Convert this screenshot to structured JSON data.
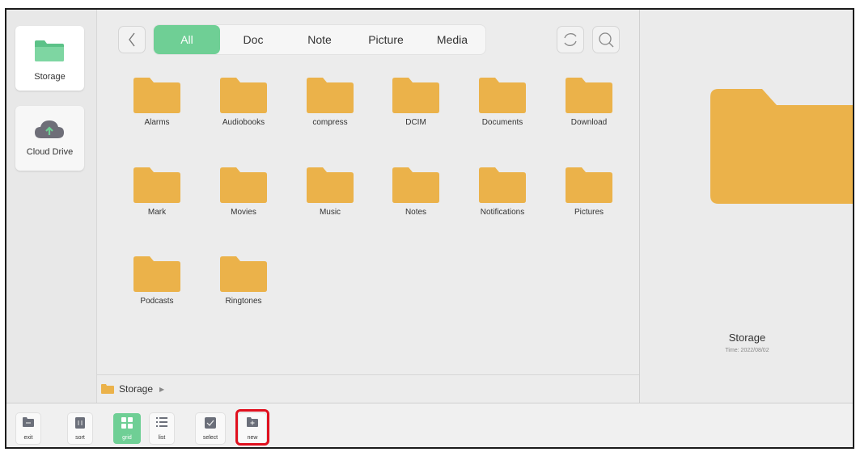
{
  "sidebar": {
    "items": [
      {
        "label": "Storage",
        "icon": "folder-icon",
        "active": true
      },
      {
        "label": "Cloud Drive",
        "icon": "cloud-upload-icon",
        "active": false
      }
    ]
  },
  "tabs": [
    {
      "label": "All",
      "active": true
    },
    {
      "label": "Doc",
      "active": false
    },
    {
      "label": "Note",
      "active": false
    },
    {
      "label": "Picture",
      "active": false
    },
    {
      "label": "Media",
      "active": false
    }
  ],
  "header_icons": [
    "back-icon",
    "refresh-icon",
    "search-icon"
  ],
  "folders": [
    "Alarms",
    "Audiobooks",
    "compress",
    "DCIM",
    "Documents",
    "Download",
    "Mark",
    "Movies",
    "Music",
    "Notes",
    "Notifications",
    "Pictures",
    "Podcasts",
    "Ringtones"
  ],
  "breadcrumb": {
    "label": "Storage"
  },
  "preview": {
    "name": "Storage",
    "time": "Time: 2022/08/02"
  },
  "toolbar": {
    "exit": "exit",
    "sort": "sort",
    "grid": "grid",
    "list": "list",
    "select": "select",
    "new": "new"
  },
  "colors": {
    "accent": "#6fcf95",
    "folder": "#ebb24a",
    "highlight": "#e0101e"
  }
}
